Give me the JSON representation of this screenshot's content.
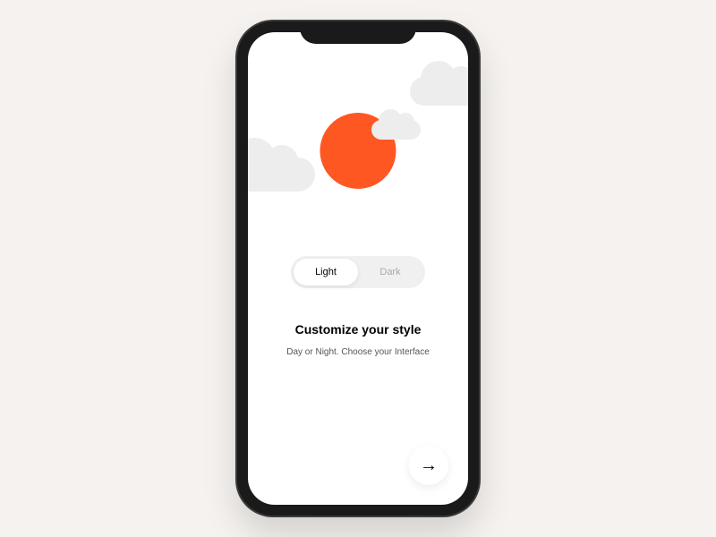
{
  "theme_toggle": {
    "options": [
      {
        "label": "Light",
        "active": true
      },
      {
        "label": "Dark",
        "active": false
      }
    ]
  },
  "content": {
    "heading": "Customize your style",
    "subtext": "Day or Night. Choose your Interface"
  },
  "colors": {
    "sun": "#ff5722",
    "cloud": "#ededed",
    "background": "#f5f2ef"
  }
}
